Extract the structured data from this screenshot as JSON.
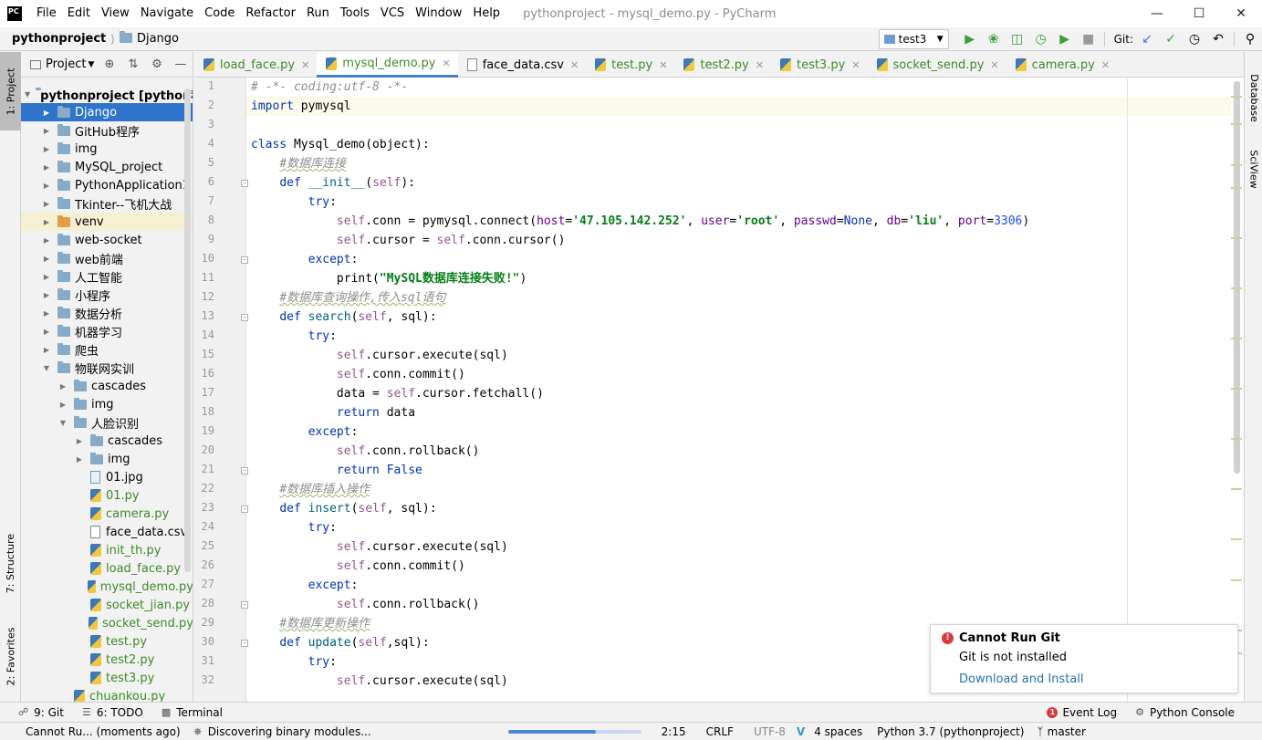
{
  "app": {
    "logo": "PC",
    "window_title": "pythonproject - mysql_demo.py - PyCharm",
    "menu": [
      "File",
      "Edit",
      "View",
      "Navigate",
      "Code",
      "Refactor",
      "Run",
      "Tools",
      "VCS",
      "Window",
      "Help"
    ],
    "window_controls": [
      "minimize-icon",
      "maximize-icon",
      "close-icon"
    ]
  },
  "navbar": {
    "breadcrumb": [
      "pythonproject",
      "Django"
    ],
    "run_config": "test3",
    "git_label": "Git:",
    "icons": [
      "run-icon",
      "debug-icon",
      "coverage-icon",
      "profile-icon",
      "run-with-icon",
      "stop-icon",
      "git-update-icon",
      "git-commit-icon",
      "history-icon",
      "rollback-icon",
      "search-everywhere-icon"
    ]
  },
  "side_tabs": {
    "left": [
      "1: Project",
      "7: Structure",
      "2: Favorites"
    ],
    "right": [
      "Database",
      "SciView"
    ]
  },
  "project_panel": {
    "title": "Project",
    "tree": [
      {
        "label": "pythonproject [python程序",
        "kind": "folder",
        "depth": 0,
        "expanded": true
      },
      {
        "label": "Django",
        "kind": "folder",
        "depth": 1,
        "selected": true
      },
      {
        "label": "GitHub程序",
        "kind": "folder",
        "depth": 1
      },
      {
        "label": "img",
        "kind": "folder",
        "depth": 1
      },
      {
        "label": "MySQL_project",
        "kind": "folder",
        "depth": 1
      },
      {
        "label": "PythonApplication1",
        "kind": "folder",
        "depth": 1
      },
      {
        "label": "Tkinter--飞机大战",
        "kind": "folder",
        "depth": 1
      },
      {
        "label": "venv",
        "kind": "folder-orange",
        "depth": 1,
        "venv": true
      },
      {
        "label": "web-socket",
        "kind": "folder",
        "depth": 1
      },
      {
        "label": "web前端",
        "kind": "folder",
        "depth": 1
      },
      {
        "label": "人工智能",
        "kind": "folder",
        "depth": 1
      },
      {
        "label": "小程序",
        "kind": "folder",
        "depth": 1
      },
      {
        "label": "数据分析",
        "kind": "folder",
        "depth": 1
      },
      {
        "label": "机器学习",
        "kind": "folder",
        "depth": 1
      },
      {
        "label": "爬虫",
        "kind": "folder",
        "depth": 1
      },
      {
        "label": "物联网实训",
        "kind": "folder",
        "depth": 1,
        "expanded": true
      },
      {
        "label": "cascades",
        "kind": "folder",
        "depth": 2
      },
      {
        "label": "img",
        "kind": "folder",
        "depth": 2
      },
      {
        "label": "人脸识别",
        "kind": "folder",
        "depth": 2,
        "expanded": true
      },
      {
        "label": "cascades",
        "kind": "folder",
        "depth": 3
      },
      {
        "label": "img",
        "kind": "folder",
        "depth": 3
      },
      {
        "label": "01.jpg",
        "kind": "jpg",
        "depth": 3
      },
      {
        "label": "01.py",
        "kind": "py",
        "depth": 3
      },
      {
        "label": "camera.py",
        "kind": "py",
        "depth": 3
      },
      {
        "label": "face_data.csv",
        "kind": "csv",
        "depth": 3
      },
      {
        "label": "init_th.py",
        "kind": "py",
        "depth": 3
      },
      {
        "label": "load_face.py",
        "kind": "py",
        "depth": 3
      },
      {
        "label": "mysql_demo.py",
        "kind": "py",
        "depth": 3
      },
      {
        "label": "socket_jian.py",
        "kind": "py",
        "depth": 3
      },
      {
        "label": "socket_send.py",
        "kind": "py",
        "depth": 3
      },
      {
        "label": "test.py",
        "kind": "py",
        "depth": 3
      },
      {
        "label": "test2.py",
        "kind": "py",
        "depth": 3
      },
      {
        "label": "test3.py",
        "kind": "py",
        "depth": 3
      },
      {
        "label": "chuankou.py",
        "kind": "py",
        "depth": 2
      }
    ]
  },
  "editor": {
    "tabs": [
      {
        "label": "load_face.py",
        "kind": "py"
      },
      {
        "label": "mysql_demo.py",
        "kind": "py",
        "active": true
      },
      {
        "label": "face_data.csv",
        "kind": "csv"
      },
      {
        "label": "test.py",
        "kind": "py"
      },
      {
        "label": "test2.py",
        "kind": "py"
      },
      {
        "label": "test3.py",
        "kind": "py"
      },
      {
        "label": "socket_send.py",
        "kind": "py"
      },
      {
        "label": "camera.py",
        "kind": "py"
      }
    ],
    "line_numbers": [
      "1",
      "2",
      "3",
      "4",
      "5",
      "6",
      "7",
      "8",
      "9",
      "10",
      "11",
      "12",
      "13",
      "14",
      "15",
      "16",
      "17",
      "18",
      "19",
      "20",
      "21",
      "22",
      "23",
      "24",
      "25",
      "26",
      "27",
      "28",
      "29",
      "30",
      "31",
      "32"
    ],
    "code_lines": [
      [
        [
          "cm",
          "# -*- coding:utf-8 -*-"
        ]
      ],
      [
        [
          "kw",
          "import"
        ],
        [
          "",
          " pymysql"
        ]
      ],
      [],
      [
        [
          "kw",
          "class"
        ],
        [
          "",
          " Mysql_demo(object):"
        ]
      ],
      [
        [
          "",
          "    "
        ],
        [
          "cm",
          "#数据库连接"
        ]
      ],
      [
        [
          "",
          "    "
        ],
        [
          "kw",
          "def"
        ],
        [
          "fn",
          " __init__"
        ],
        [
          "",
          "("
        ],
        [
          "sf",
          "self"
        ],
        [
          "",
          "):"
        ]
      ],
      [
        [
          "",
          "        "
        ],
        [
          "kw",
          "try"
        ],
        [
          "",
          ":"
        ]
      ],
      [
        [
          "",
          "            "
        ],
        [
          "sf",
          "self"
        ],
        [
          "",
          ".conn = pymysql.connect("
        ],
        [
          "pm",
          "host"
        ],
        [
          "",
          "="
        ],
        [
          "st",
          "'47.105.142.252'"
        ],
        [
          "",
          ", "
        ],
        [
          "pm",
          "user"
        ],
        [
          "",
          "="
        ],
        [
          "st",
          "'root'"
        ],
        [
          "",
          ", "
        ],
        [
          "pm",
          "passwd"
        ],
        [
          "",
          "="
        ],
        [
          "kw",
          "None"
        ],
        [
          "",
          ", "
        ],
        [
          "pm",
          "db"
        ],
        [
          "",
          "="
        ],
        [
          "st",
          "'liu'"
        ],
        [
          "",
          ", "
        ],
        [
          "pm",
          "port"
        ],
        [
          "",
          "="
        ],
        [
          "nm",
          "3306"
        ],
        [
          "",
          ")"
        ]
      ],
      [
        [
          "",
          "            "
        ],
        [
          "sf",
          "self"
        ],
        [
          "",
          ".cursor = "
        ],
        [
          "sf",
          "self"
        ],
        [
          "",
          ".conn.cursor()"
        ]
      ],
      [
        [
          "",
          "        "
        ],
        [
          "kw",
          "except"
        ],
        [
          "",
          ":"
        ]
      ],
      [
        [
          "",
          "            print("
        ],
        [
          "st",
          "\"MySQL数据库连接失败!\""
        ],
        [
          "",
          ")"
        ]
      ],
      [
        [
          "",
          "    "
        ],
        [
          "cm",
          "#数据库查询操作,传入sql语句"
        ]
      ],
      [
        [
          "",
          "    "
        ],
        [
          "kw",
          "def"
        ],
        [
          "fn",
          " search"
        ],
        [
          "",
          "("
        ],
        [
          "sf",
          "self"
        ],
        [
          "",
          ", sql):"
        ]
      ],
      [
        [
          "",
          "        "
        ],
        [
          "kw",
          "try"
        ],
        [
          "",
          ":"
        ]
      ],
      [
        [
          "",
          "            "
        ],
        [
          "sf",
          "self"
        ],
        [
          "",
          ".cursor.execute(sql)"
        ]
      ],
      [
        [
          "",
          "            "
        ],
        [
          "sf",
          "self"
        ],
        [
          "",
          ".conn.commit()"
        ]
      ],
      [
        [
          "",
          "            data = "
        ],
        [
          "sf",
          "self"
        ],
        [
          "",
          ".cursor.fetchall()"
        ]
      ],
      [
        [
          "",
          "            "
        ],
        [
          "kw",
          "return"
        ],
        [
          "",
          " data"
        ]
      ],
      [
        [
          "",
          "        "
        ],
        [
          "kw",
          "except"
        ],
        [
          "",
          ":"
        ]
      ],
      [
        [
          "",
          "            "
        ],
        [
          "sf",
          "self"
        ],
        [
          "",
          ".conn.rollback()"
        ]
      ],
      [
        [
          "",
          "            "
        ],
        [
          "kw",
          "return"
        ],
        [
          "kw",
          " False"
        ]
      ],
      [
        [
          "",
          "    "
        ],
        [
          "cm",
          "#数据库插入操作"
        ]
      ],
      [
        [
          "",
          "    "
        ],
        [
          "kw",
          "def"
        ],
        [
          "fn",
          " insert"
        ],
        [
          "",
          "("
        ],
        [
          "sf",
          "self"
        ],
        [
          "",
          ", sql):"
        ]
      ],
      [
        [
          "",
          "        "
        ],
        [
          "kw",
          "try"
        ],
        [
          "",
          ":"
        ]
      ],
      [
        [
          "",
          "            "
        ],
        [
          "sf",
          "self"
        ],
        [
          "",
          ".cursor.execute(sql)"
        ]
      ],
      [
        [
          "",
          "            "
        ],
        [
          "sf",
          "self"
        ],
        [
          "",
          ".conn.commit()"
        ]
      ],
      [
        [
          "",
          "        "
        ],
        [
          "kw",
          "except"
        ],
        [
          "",
          ":"
        ]
      ],
      [
        [
          "",
          "            "
        ],
        [
          "sf",
          "self"
        ],
        [
          "",
          ".conn.rollback()"
        ]
      ],
      [
        [
          "",
          "    "
        ],
        [
          "cm",
          "#数据库更新操作"
        ]
      ],
      [
        [
          "",
          "    "
        ],
        [
          "kw",
          "def"
        ],
        [
          "fn",
          " update"
        ],
        [
          "",
          "("
        ],
        [
          "sf",
          "self"
        ],
        [
          "",
          ",sql):"
        ]
      ],
      [
        [
          "",
          "        "
        ],
        [
          "kw",
          "try"
        ],
        [
          "",
          ":"
        ]
      ],
      [
        [
          "",
          "            "
        ],
        [
          "sf",
          "self"
        ],
        [
          "",
          ".cursor.execute(sql)"
        ]
      ]
    ]
  },
  "notification": {
    "title": "Cannot Run Git",
    "body": "Git is not installed",
    "link": "Download and Install"
  },
  "bottom_tools": {
    "left": [
      {
        "label": "9: Git",
        "icon": "git-icon"
      },
      {
        "label": "6: TODO",
        "icon": "todo-icon"
      },
      {
        "label": "Terminal",
        "icon": "terminal-icon"
      }
    ],
    "right": [
      {
        "label": "Event Log",
        "icon": "event-log-icon",
        "badge": "1"
      },
      {
        "label": "Python Console",
        "icon": "python-console-icon"
      }
    ]
  },
  "statusbar": {
    "message": "Cannot Ru... (moments ago)",
    "background_task": "Discovering binary modules...",
    "progress": 0.66,
    "position": "2:15",
    "line_separator": "CRLF",
    "encoding": "UTF-8",
    "indent": "4 spaces",
    "interpreter": "Python 3.7 (pythonproject)",
    "branch": "master"
  }
}
